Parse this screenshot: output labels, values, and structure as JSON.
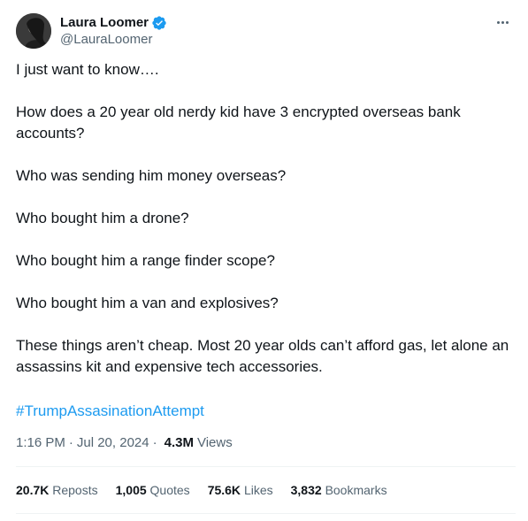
{
  "author": {
    "display_name": "Laura Loomer",
    "handle": "@LauraLoomer",
    "verified_icon": "verified-badge-icon",
    "avatar_icon": "avatar"
  },
  "tweet": {
    "paragraphs": [
      "I just want to know….",
      "How does a 20 year old nerdy kid have 3 encrypted overseas bank accounts?",
      "Who was sending him money overseas?",
      "Who bought him a drone?",
      "Who bought him a range finder scope?",
      "Who bought him a van and explosives?",
      "These things aren’t cheap. Most 20 year olds can’t afford gas, let alone an assassins kit and expensive tech accessories."
    ],
    "hashtag": "#TrumpAssasinationAttempt"
  },
  "meta": {
    "time": "1:16 PM",
    "separator": "·",
    "date": "Jul 20, 2024",
    "views_count": "4.3M",
    "views_label": "Views"
  },
  "stats": {
    "reposts_count": "20.7K",
    "reposts_label": "Reposts",
    "quotes_count": "1,005",
    "quotes_label": "Quotes",
    "likes_count": "75.6K",
    "likes_label": "Likes",
    "bookmarks_count": "3,832",
    "bookmarks_label": "Bookmarks"
  },
  "colors": {
    "text": "#0f1419",
    "secondary": "#536471",
    "accent": "#1d9bf0",
    "divider": "#eff3f4"
  }
}
